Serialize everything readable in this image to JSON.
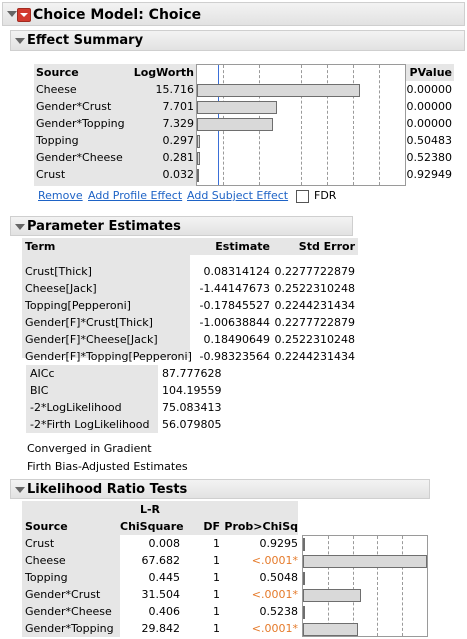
{
  "report_title": "Choice Model: Choice",
  "effect_summary": {
    "title": "Effect Summary",
    "headers": {
      "source": "Source",
      "logworth": "LogWorth",
      "pvalue": "PValue"
    },
    "rows": [
      {
        "source": "Cheese",
        "logworth": "15.716",
        "pvalue": "0.00000",
        "value": 15.716
      },
      {
        "source": "Gender*Crust",
        "logworth": "7.701",
        "pvalue": "0.00000",
        "value": 7.701
      },
      {
        "source": "Gender*Topping",
        "logworth": "7.329",
        "pvalue": "0.00000",
        "value": 7.329
      },
      {
        "source": "Topping",
        "logworth": "0.297",
        "pvalue": "0.50483",
        "value": 0.297
      },
      {
        "source": "Gender*Cheese",
        "logworth": "0.281",
        "pvalue": "0.52380",
        "value": 0.281
      },
      {
        "source": "Crust",
        "logworth": "0.032",
        "pvalue": "0.92949",
        "value": 0.032
      }
    ],
    "axis_max": 20,
    "reference_line": 2,
    "buttons": {
      "remove": "Remove",
      "add_profile": "Add Profile Effect",
      "add_subject": "Add Subject Effect"
    },
    "fdr_label": "FDR"
  },
  "parameter_estimates": {
    "title": "Parameter Estimates",
    "headers": {
      "term": "Term",
      "estimate": "Estimate",
      "stderr": "Std Error"
    },
    "rows": [
      {
        "term": "Crust[Thick]",
        "estimate": "0.08314124",
        "stderr": "0.2277722879"
      },
      {
        "term": "Cheese[Jack]",
        "estimate": "-1.44147673",
        "stderr": "0.2522310248"
      },
      {
        "term": "Topping[Pepperoni]",
        "estimate": "-0.17845527",
        "stderr": "0.2244231434"
      },
      {
        "term": "Gender[F]*Crust[Thick]",
        "estimate": "-1.00638844",
        "stderr": "0.2277722879"
      },
      {
        "term": "Gender[F]*Cheese[Jack]",
        "estimate": "0.18490649",
        "stderr": "0.2522310248"
      },
      {
        "term": "Gender[F]*Topping[Pepperoni]",
        "estimate": "-0.98323564",
        "stderr": "0.2244231434"
      }
    ],
    "stats": [
      {
        "label": "AICc",
        "value": "87.777628"
      },
      {
        "label": "BIC",
        "value": "104.19559"
      },
      {
        "label": "-2*LogLikelihood",
        "value": "75.083413"
      },
      {
        "label": "-2*Firth LogLikelihood",
        "value": "56.079805"
      }
    ],
    "notes": [
      "Converged in Gradient",
      "Firth Bias-Adjusted Estimates"
    ]
  },
  "likelihood_ratio": {
    "title": "Likelihood Ratio Tests",
    "headers": {
      "source": "Source",
      "lr_top": "L-R",
      "lr_bottom": "ChiSquare",
      "df": "DF",
      "prob": "Prob>ChiSq"
    },
    "rows": [
      {
        "source": "Crust",
        "chisq": "0.008",
        "df": "1",
        "prob": "0.9295",
        "sig": false,
        "value": 0.008
      },
      {
        "source": "Cheese",
        "chisq": "67.682",
        "df": "1",
        "prob": "<.0001*",
        "sig": true,
        "value": 67.682
      },
      {
        "source": "Topping",
        "chisq": "0.445",
        "df": "1",
        "prob": "0.5048",
        "sig": false,
        "value": 0.445
      },
      {
        "source": "Gender*Crust",
        "chisq": "31.504",
        "df": "1",
        "prob": "<.0001*",
        "sig": true,
        "value": 31.504
      },
      {
        "source": "Gender*Cheese",
        "chisq": "0.406",
        "df": "1",
        "prob": "0.5238",
        "sig": false,
        "value": 0.406
      },
      {
        "source": "Gender*Topping",
        "chisq": "29.842",
        "df": "1",
        "prob": "<.0001*",
        "sig": true,
        "value": 29.842
      }
    ],
    "axis_max": 67.682
  },
  "colors": {
    "significant": "#e57a2a",
    "link": "#1e63c6",
    "header": "#e6e6e6"
  }
}
